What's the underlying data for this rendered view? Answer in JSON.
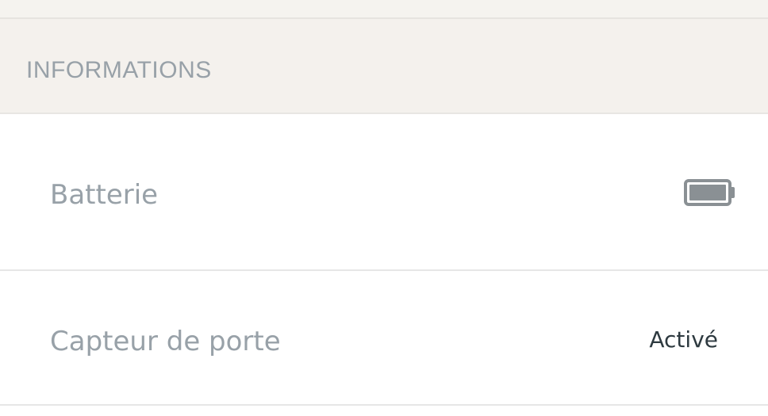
{
  "section": {
    "title": "INFORMATIONS"
  },
  "rows": [
    {
      "label": "Batterie",
      "icon": "battery-full-icon",
      "level": 1.0
    },
    {
      "label": "Capteur de porte",
      "value": "Activé"
    }
  ],
  "colors": {
    "section_bg": "#f4f1ed",
    "label": "#98a1a8",
    "value": "#2e3a40",
    "icon": "#8a9094",
    "divider": "#e6e6e6"
  }
}
